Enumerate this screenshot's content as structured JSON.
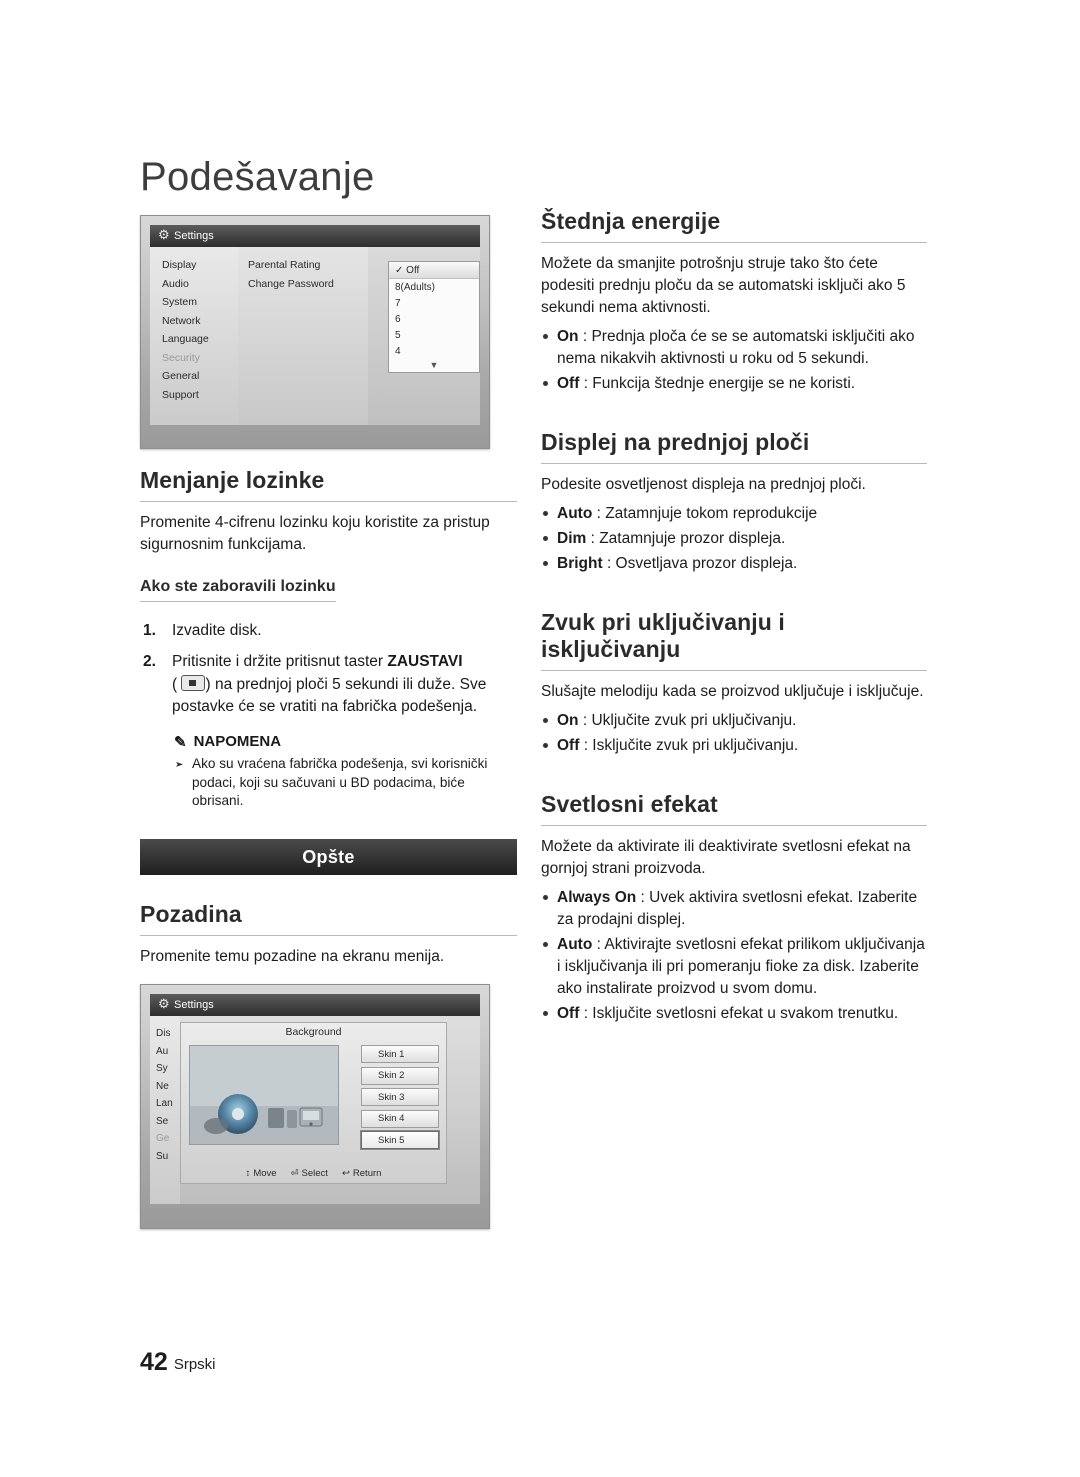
{
  "page": {
    "title": "Podešavanje",
    "footer_number": "42",
    "footer_language": "Srpski"
  },
  "screenshot1": {
    "titlebar": "Settings",
    "menu": [
      "Display",
      "Audio",
      "System",
      "Network",
      "Language",
      "Security",
      "General",
      "Support"
    ],
    "dimmed_item": "Security",
    "column2": [
      "Parental Rating",
      "Change Password"
    ],
    "rating_options": [
      "Off",
      "8(Adults)",
      "7",
      "6",
      "5",
      "4"
    ],
    "selected_rating": "Off",
    "check_mark": "✓",
    "scroll_arrow": "▼"
  },
  "screenshot2": {
    "titlebar": "Settings",
    "menu": [
      "Dis",
      "Au",
      "Sy",
      "Ne",
      "Lan",
      "Se",
      "Ge",
      "Su"
    ],
    "dimmed_item": "Ge",
    "panel_title": "Background",
    "skins": [
      "Skin 1",
      "Skin 2",
      "Skin 3",
      "Skin 4",
      "Skin 5"
    ],
    "selected_skin": "Skin 5",
    "footer": [
      {
        "key": "↕",
        "label": "Move"
      },
      {
        "key": "⏎",
        "label": "Select"
      },
      {
        "key": "↩",
        "label": "Return"
      }
    ]
  },
  "left": {
    "s1": {
      "heading": "Menjanje lozinke",
      "body": "Promenite 4-cifrenu lozinku koju koristite za pristup sigurnosnim funkcijama.",
      "sub": "Ako ste zaboravili lozinku",
      "steps": [
        {
          "pre": "Izvadite disk.",
          "post": ""
        },
        {
          "pre": "Pritisnite i držite pritisnut taster ",
          "bold": "ZAUSTAVI",
          "mid": "(",
          "post": ") na prednjoj ploči 5 sekundi ili duže. Sve postavke će se vratiti na fabrička podešenja."
        }
      ],
      "note_title": "NAPOMENA",
      "note_icon": "✎",
      "notes": [
        "Ako su vraćena fabrička podešenja, svi korisnički podaci, koji su sačuvani u BD podacima, biće obrisani."
      ]
    },
    "band": "Opšte",
    "s2": {
      "heading": "Pozadina",
      "body": "Promenite temu pozadine na ekranu menija."
    }
  },
  "right": {
    "s1": {
      "heading": "Štednja energije",
      "body": "Možete da smanjite potrošnju struje tako što ćete podesiti prednju ploču da se automatski isključi ako 5 sekundi nema aktivnosti.",
      "bullets": [
        {
          "term": "On",
          "text": " : Prednja ploča će se se automatski isključiti ako nema nikakvih aktivnosti u roku od 5 sekundi."
        },
        {
          "term": "Off",
          "text": " : Funkcija štednje energije se ne koristi."
        }
      ]
    },
    "s2": {
      "heading": "Displej na prednjoj ploči",
      "body": "Podesite osvetljenost displeja na prednjoj ploči.",
      "bullets": [
        {
          "term": "Auto",
          "text": " : Zatamnjuje tokom reprodukcije"
        },
        {
          "term": "Dim",
          "text": " : Zatamnjuje prozor displeja."
        },
        {
          "term": "Bright",
          "text": " : Osvetljava prozor displeja."
        }
      ]
    },
    "s3": {
      "heading": "Zvuk pri uključivanju i isključivanju",
      "body": "Slušajte melodiju kada se proizvod uključuje i isključuje.",
      "bullets": [
        {
          "term": "On",
          "text": " : Uključite zvuk pri uključivanju."
        },
        {
          "term": "Off",
          "text": " : Isključite zvuk pri uključivanju."
        }
      ]
    },
    "s4": {
      "heading": "Svetlosni efekat",
      "body": "Možete da aktivirate ili deaktivirate svetlosni efekat na gornjoj strani proizvoda.",
      "bullets": [
        {
          "term": "Always On",
          "text": " : Uvek aktivira svetlosni efekat. Izaberite za prodajni displej."
        },
        {
          "term": "Auto",
          "text": " : Aktivirajte svetlosni efekat prilikom uključivanja i isključivanja ili pri pomeranju fioke za disk. Izaberite ako instalirate proizvod u svom domu."
        },
        {
          "term": "Off",
          "text": " : Isključite svetlosni efekat u svakom trenutku."
        }
      ]
    }
  }
}
